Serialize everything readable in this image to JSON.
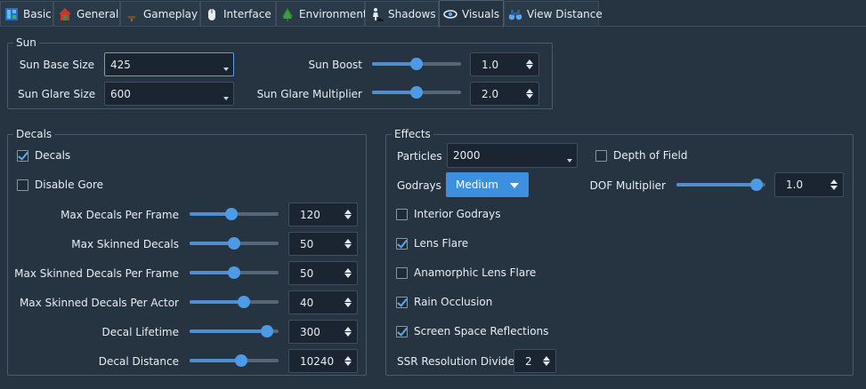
{
  "tabs": [
    {
      "label": "Basic",
      "icon": "basic-icon"
    },
    {
      "label": "General",
      "icon": "house-icon"
    },
    {
      "label": "Gameplay",
      "icon": "gameplay-icon"
    },
    {
      "label": "Interface",
      "icon": "mouse-icon"
    },
    {
      "label": "Environment",
      "icon": "tree-icon"
    },
    {
      "label": "Shadows",
      "icon": "shadow-figure-icon"
    },
    {
      "label": "Visuals",
      "icon": "eye-icon"
    },
    {
      "label": "View Distance",
      "icon": "binoculars-icon"
    }
  ],
  "active_tab": "Visuals",
  "sun": {
    "title": "Sun",
    "base_size_label": "Sun Base Size",
    "base_size_value": "425",
    "glare_size_label": "Sun Glare Size",
    "glare_size_value": "600",
    "boost_label": "Sun Boost",
    "boost_value": "1.0",
    "boost_level": 0.5,
    "glare_mult_label": "Sun Glare Multiplier",
    "glare_mult_value": "2.0",
    "glare_mult_level": 0.5
  },
  "decals": {
    "title": "Decals",
    "decals_label": "Decals",
    "decals_checked": true,
    "disable_gore_label": "Disable Gore",
    "disable_gore_checked": false,
    "rows": [
      {
        "label": "Max Decals Per Frame",
        "value": "120",
        "level": 0.47
      },
      {
        "label": "Max Skinned Decals",
        "value": "50",
        "level": 0.5
      },
      {
        "label": "Max Skinned Decals Per Frame",
        "value": "50",
        "level": 0.5
      },
      {
        "label": "Max Skinned Decals Per Actor",
        "value": "40",
        "level": 0.63
      },
      {
        "label": "Decal Lifetime",
        "value": "300",
        "level": 0.93
      },
      {
        "label": "Decal Distance",
        "value": "10240",
        "level": 0.59
      }
    ]
  },
  "effects": {
    "title": "Effects",
    "particles_label": "Particles",
    "particles_value": "2000",
    "godrays_label": "Godrays",
    "godrays_value": "Medium",
    "depth_of_field_label": "Depth of Field",
    "depth_of_field_checked": false,
    "dof_mult_label": "DOF Multiplier",
    "dof_mult_value": "1.0",
    "dof_mult_level": 0.97,
    "checks": [
      {
        "label": "Interior Godrays",
        "checked": false
      },
      {
        "label": "Lens Flare",
        "checked": true
      },
      {
        "label": "Anamorphic Lens Flare",
        "checked": false
      },
      {
        "label": "Rain Occlusion",
        "checked": true
      },
      {
        "label": "Screen Space Reflections",
        "checked": true
      }
    ],
    "ssr_divider_label": "SSR Resolution Divider",
    "ssr_divider_value": "2"
  },
  "colors": {
    "background": "#263442",
    "accent": "#3d8fe0",
    "field": "#1b2531"
  }
}
